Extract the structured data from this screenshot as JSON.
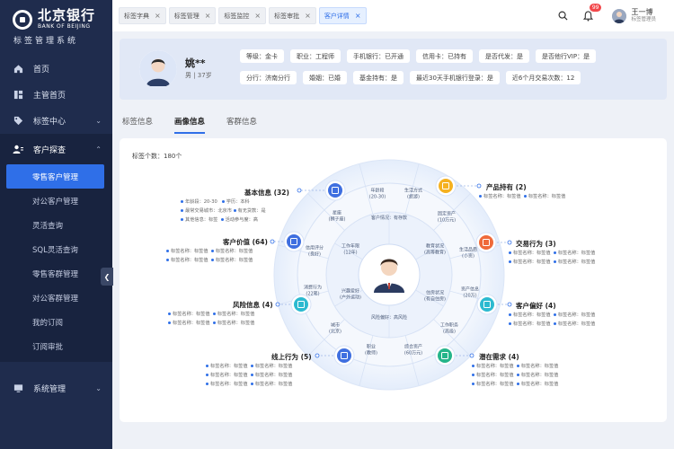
{
  "brand": {
    "name": "北京银行",
    "en": "BANK OF BEIJING",
    "system": "标签管理系统"
  },
  "nav": {
    "home": "首页",
    "owner_home": "主管首页",
    "tag_center": "标签中心",
    "customer_explore": "客户探查",
    "sub_items": [
      "零售客户管理",
      "对公客户管理",
      "灵活查询",
      "SQL灵活查询",
      "零售客群管理",
      "对公客群管理",
      "我的订阅",
      "订阅审批"
    ],
    "system_mgmt": "系统管理"
  },
  "tabs": [
    {
      "label": "标签字典"
    },
    {
      "label": "标签管理"
    },
    {
      "label": "标签监控"
    },
    {
      "label": "标签审批"
    },
    {
      "label": "客户详情"
    }
  ],
  "top": {
    "notify_count": "99",
    "user_name": "王一博",
    "user_role": "标签管理员"
  },
  "profile": {
    "name": "姚**",
    "sub": "男 | 37岁",
    "row1": [
      "等级：金卡",
      "职业：工程师",
      "手机银行：已开通",
      "信用卡：已持有",
      "是否代发：是",
      "是否他行VIP：是"
    ],
    "row2": [
      "分行：济南分行",
      "婚姻：已婚",
      "基金持有：是",
      "最近30天手机银行登录：是",
      "近6个月交易次数：12"
    ]
  },
  "view_tabs": [
    "标签信息",
    "画像信息",
    "客群信息"
  ],
  "tag_count": "标签个数：180个",
  "colors": {
    "accent": "#2f6fe8"
  },
  "blocks": {
    "basic": {
      "title": "基本信息",
      "count": "(32)",
      "items": [
        "年龄段：20-30",
        "学历：本科",
        "最常交易城市：北京市",
        "有无贷款：是",
        "其他信息：标签",
        "活动参与度：高"
      ]
    },
    "value": {
      "title": "客户价值",
      "count": "(64)",
      "items": [
        "标签名称：标签值",
        "标签名称：标签值",
        "标签名称：标签值",
        "标签名称：标签值"
      ]
    },
    "risk": {
      "title": "风险信息",
      "count": "(4)",
      "items": [
        "标签名称：标签值",
        "标签名称：标签值",
        "标签名称：标签值",
        "标签名称：标签值"
      ]
    },
    "online": {
      "title": "线上行为",
      "count": "(5)",
      "items": [
        "标签名称：标签值",
        "标签名称：标签值",
        "标签名称：标签值",
        "标签名称：标签值",
        "标签名称：标签值",
        "标签名称：标签值"
      ]
    },
    "product": {
      "title": "产品持有",
      "count": "(2)",
      "items": [
        "标签名称：标签值",
        "标签名称：标签值"
      ]
    },
    "trade": {
      "title": "交易行为",
      "count": "(3)",
      "items": [
        "标签名称：标签值",
        "标签名称：标签值",
        "标签名称：标签值",
        "标签名称：标签值"
      ]
    },
    "pref": {
      "title": "客户偏好",
      "count": "(4)",
      "items": [
        "标签名称：标签值",
        "标签名称：标签值",
        "标签名称：标签值",
        "标签名称：标签值"
      ]
    },
    "potential": {
      "title": "潜在需求",
      "count": "(4)",
      "items": [
        "标签名称：标签值",
        "标签名称：标签值",
        "标签名称：标签值",
        "标签名称：标签值",
        "标签名称：标签值",
        "标签名称：标签值"
      ]
    }
  },
  "ring_outer": [
    "年龄段\n(20-30)",
    "生活方式\n(旅游)",
    "固定资产\n(10万元)",
    "生活品质\n(小资)",
    "资产信息\n(20万)",
    "工作职务\n(高级)",
    "综合资产\n(60万元)",
    "职业\n(教师)",
    "城市\n(北京)",
    "消费行为\n(22笔)",
    "信用评分\n(良好)",
    "星座\n(狮子座)"
  ],
  "ring_inner": [
    "客户情况：有存款",
    "教育状况\n(高等教育)",
    "住房状况\n(有自住房)",
    "风险偏好：高风险",
    "兴趣爱好\n(户外运动)",
    "工作年限\n(12年)"
  ]
}
